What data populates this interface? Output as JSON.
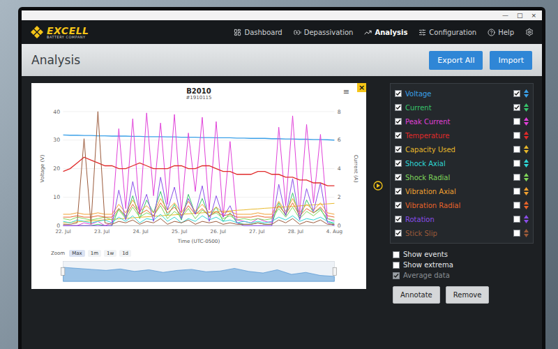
{
  "window": {
    "controls": [
      "—",
      "□",
      "×"
    ]
  },
  "logo": {
    "name": "EXCELL",
    "tagline": "BATTERY COMPANY"
  },
  "nav": [
    {
      "label": "Dashboard",
      "selected": false
    },
    {
      "label": "Depassivation",
      "selected": false
    },
    {
      "label": "Analysis",
      "selected": true
    },
    {
      "label": "Configuration",
      "selected": false
    },
    {
      "label": "Help",
      "selected": false
    }
  ],
  "page": {
    "title": "Analysis",
    "buttons": [
      "Export All",
      "Import"
    ]
  },
  "chart": {
    "title": "B2010",
    "subtitle": "#1910115",
    "menu_glyph": "≡",
    "close_glyph": "×",
    "left_ticks": [
      "40",
      "30",
      "20",
      "10",
      "0"
    ],
    "right_ticks": [
      "8",
      "6",
      "4",
      "2",
      "0"
    ],
    "left_title": "Voltage (V)",
    "right_title": "Current (A)",
    "x_title": "Time (UTC-0500)",
    "x_ticks": [
      "22. Jul",
      "23. Jul",
      "24. Jul",
      "25. Jul",
      "26. Jul",
      "27. Jul",
      "28. Jul",
      "4. Aug"
    ],
    "zoom": {
      "label": "Zoom",
      "buttons": [
        {
          "label": "Max",
          "selected": true
        },
        {
          "label": "1m",
          "selected": false
        },
        {
          "label": "1w",
          "selected": false
        },
        {
          "label": "1d",
          "selected": false
        }
      ]
    },
    "navigator": {
      "max": 10,
      "values": [
        7,
        6.5,
        6,
        5.5,
        6.2,
        5,
        5.8,
        4.5,
        5.5,
        6,
        4.8,
        5.2,
        6.5,
        5,
        4.2,
        5.8,
        3.5,
        4.5,
        3,
        2.5
      ]
    }
  },
  "series": [
    {
      "name": "Voltage",
      "color": "#3aa0e8",
      "shown": true,
      "axis_shown": true,
      "axis": "left",
      "values": [
        31.8,
        31.7,
        31.7,
        31.6,
        31.6,
        31.5,
        31.5,
        31.4,
        31.4,
        31.4,
        31.3,
        31.3,
        31.2,
        31.2,
        31.2,
        31.1,
        31.1,
        31.0,
        31.0,
        31.0,
        30.9,
        30.9,
        30.8,
        30.8,
        30.8,
        30.7,
        30.7,
        30.6,
        30.6,
        30.6,
        30.5,
        30.5,
        30.4,
        30.4,
        30.3,
        30.3,
        30.2,
        30.2,
        30.1,
        30.0
      ]
    },
    {
      "name": "Current",
      "color": "#37c46b",
      "shown": true,
      "axis_shown": true,
      "axis": "right",
      "values": [
        0,
        0,
        0,
        0,
        0,
        0.1,
        0,
        0,
        1.2,
        0.6,
        2.1,
        0.5,
        1.8,
        0.9,
        2.4,
        0.7,
        1.5,
        0.4,
        2.2,
        0.8,
        1.9,
        0.6,
        1.3,
        0.3,
        0.9,
        0.2,
        0.1,
        0.1,
        0.2,
        0.1,
        0.1,
        1.6,
        0.7,
        2.3,
        0.5,
        1.8,
        0.9,
        1.2,
        0.3,
        0.1
      ]
    },
    {
      "name": "Peak Current",
      "color": "#e040d8",
      "shown": true,
      "axis_shown": false,
      "axis": "right",
      "values": [
        0,
        0,
        0,
        0.2,
        0.1,
        0.3,
        0,
        0.2,
        6.8,
        1.2,
        7.5,
        0.8,
        7.9,
        2.1,
        7.2,
        1.5,
        7.8,
        0.9,
        6.5,
        2.4,
        7.6,
        1.1,
        7.3,
        0.6,
        5.9,
        0.4,
        0.3,
        0.2,
        0.5,
        0.3,
        0.2,
        6.9,
        1.4,
        7.7,
        0.8,
        7.1,
        1.6,
        6.4,
        0.5,
        0.3
      ]
    },
    {
      "name": "Temperature",
      "color": "#e02a2a",
      "shown": true,
      "axis_shown": false,
      "axis": "left",
      "values": [
        19,
        20,
        22,
        24,
        23,
        22,
        21,
        21,
        20,
        20,
        21,
        22,
        21,
        20,
        20,
        20,
        21,
        21,
        20,
        20,
        21,
        21,
        20,
        19,
        19,
        18,
        18,
        18,
        19,
        19,
        18,
        18,
        17,
        17,
        16,
        16,
        15,
        15,
        14,
        14
      ]
    },
    {
      "name": "Capacity Used",
      "color": "#e8b82a",
      "shown": true,
      "axis_shown": false,
      "axis": "right",
      "values": [
        0.2,
        0.24,
        0.27,
        0.31,
        0.34,
        0.38,
        0.41,
        0.45,
        0.48,
        0.52,
        0.55,
        0.59,
        0.62,
        0.66,
        0.69,
        0.73,
        0.76,
        0.8,
        0.83,
        0.87,
        0.9,
        0.94,
        0.97,
        1.01,
        1.04,
        1.08,
        1.11,
        1.15,
        1.18,
        1.22,
        1.25,
        1.29,
        1.32,
        1.36,
        1.39,
        1.43,
        1.46,
        1.5,
        1.53,
        1.57
      ]
    },
    {
      "name": "Shock Axial",
      "color": "#2fd6d6",
      "shown": true,
      "axis_shown": false,
      "axis": "right",
      "values": [
        0.3,
        0.2,
        0.4,
        0.3,
        0.2,
        0.3,
        0.4,
        0.2,
        0.6,
        0.3,
        0.7,
        0.2,
        0.5,
        0.4,
        0.8,
        0.3,
        0.6,
        0.2,
        0.5,
        0.3,
        0.7,
        0.4,
        0.6,
        0.3,
        0.4,
        0.2,
        0.3,
        0.2,
        0.3,
        0.2,
        0.3,
        0.6,
        0.4,
        0.7,
        0.3,
        0.5,
        0.4,
        0.6,
        0.3,
        0.2
      ]
    },
    {
      "name": "Shock Radial",
      "color": "#7fd65a",
      "shown": true,
      "axis_shown": false,
      "axis": "right",
      "values": [
        0.5,
        0.4,
        0.6,
        0.5,
        0.4,
        0.5,
        0.6,
        0.4,
        1.1,
        0.5,
        1.3,
        0.6,
        0.9,
        0.7,
        1.4,
        0.5,
        1.0,
        0.6,
        1.2,
        0.5,
        1.1,
        0.7,
        0.9,
        0.5,
        0.7,
        0.4,
        0.5,
        0.4,
        0.5,
        0.4,
        0.5,
        1.2,
        0.6,
        1.3,
        0.5,
        1.0,
        0.7,
        1.1,
        0.5,
        0.4
      ]
    },
    {
      "name": "Vibration Axial",
      "color": "#f0a030",
      "shown": true,
      "axis_shown": false,
      "axis": "right",
      "values": [
        0.8,
        0.8,
        0.9,
        0.8,
        0.8,
        0.9,
        0.8,
        0.8,
        1.5,
        0.9,
        1.8,
        1.0,
        1.4,
        0.9,
        1.9,
        1.1,
        1.6,
        0.9,
        1.7,
        1.0,
        1.5,
        0.9,
        1.3,
        0.9,
        1.0,
        0.8,
        0.8,
        0.8,
        0.9,
        0.8,
        0.8,
        1.7,
        1.0,
        1.9,
        0.9,
        1.5,
        1.1,
        1.6,
        0.9,
        0.8
      ]
    },
    {
      "name": "Vibration Radial",
      "color": "#e8642a",
      "shown": true,
      "axis_shown": false,
      "axis": "right",
      "values": [
        0.6,
        0.6,
        0.7,
        0.6,
        0.6,
        0.7,
        0.6,
        0.6,
        1.2,
        0.7,
        1.5,
        0.8,
        1.1,
        0.7,
        1.6,
        0.9,
        1.3,
        0.7,
        1.4,
        0.8,
        1.2,
        0.7,
        1.0,
        0.7,
        0.8,
        0.6,
        0.6,
        0.6,
        0.7,
        0.6,
        0.6,
        1.4,
        0.8,
        1.6,
        0.7,
        1.2,
        0.9,
        1.3,
        0.7,
        0.6
      ]
    },
    {
      "name": "Rotation",
      "color": "#8a4de8",
      "shown": true,
      "axis_shown": false,
      "axis": "right",
      "values": [
        0,
        0,
        0,
        0,
        0,
        0,
        0,
        0,
        2.5,
        0.4,
        3.1,
        0.9,
        2.2,
        0.3,
        3.4,
        1.1,
        2.7,
        0.5,
        1.9,
        0.8,
        2.8,
        0.3,
        2.1,
        0.6,
        1.4,
        0.2,
        0,
        0,
        0,
        0,
        0,
        2.9,
        0.7,
        3.3,
        0.4,
        2.6,
        1.0,
        3.0,
        0.2,
        0
      ]
    },
    {
      "name": "Stick Slip",
      "color": "#9a5a3a",
      "shown": true,
      "axis_shown": false,
      "axis": "right",
      "values": [
        0.1,
        0.1,
        0.2,
        6.1,
        0.1,
        8.0,
        0.2,
        0.1,
        0.3,
        0.2,
        0.4,
        0.1,
        0.3,
        0.2,
        0.5,
        0.1,
        0.3,
        0.2,
        0.4,
        0.1,
        0.3,
        0.2,
        0.3,
        0.1,
        0.2,
        0.1,
        0.1,
        0.1,
        0.2,
        0.1,
        0.1,
        0.4,
        0.2,
        0.5,
        0.1,
        0.3,
        0.2,
        0.4,
        0.1,
        0.1
      ]
    }
  ],
  "options": [
    {
      "label": "Show events",
      "checked": false,
      "disabled": false
    },
    {
      "label": "Show extrema",
      "checked": false,
      "disabled": false
    },
    {
      "label": "Average data",
      "checked": true,
      "disabled": true
    }
  ],
  "actions": [
    "Annotate",
    "Remove"
  ]
}
